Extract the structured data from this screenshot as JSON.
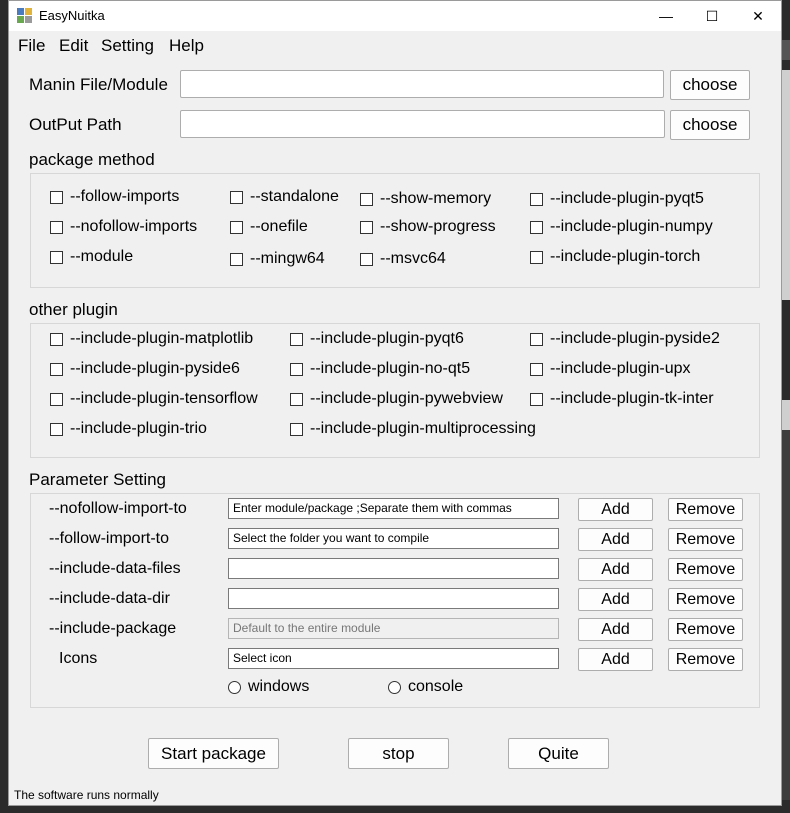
{
  "window": {
    "title": "EasyNuitka"
  },
  "titlebar": {
    "minimize": "—",
    "maximize": "☐",
    "close": "✕"
  },
  "menu": [
    "File",
    "Edit",
    "Setting",
    "Help"
  ],
  "main_file": {
    "label": "Manin File/Module",
    "value": "",
    "button": "choose"
  },
  "output_path": {
    "label": "OutPut Path",
    "value": "",
    "button": "choose"
  },
  "package_method": {
    "title": "package method",
    "options": [
      "--follow-imports",
      "--standalone",
      "--show-memory",
      "--include-plugin-pyqt5",
      "--nofollow-imports",
      "--onefile",
      "--show-progress",
      "--include-plugin-numpy",
      "--module",
      "--mingw64",
      "--msvc64",
      "--include-plugin-torch"
    ]
  },
  "other_plugin": {
    "title": "other plugin",
    "options": [
      "--include-plugin-matplotlib",
      "--include-plugin-pyqt6",
      "--include-plugin-pyside2",
      "--include-plugin-pyside6",
      "--include-plugin-no-qt5",
      "--include-plugin-upx",
      "--include-plugin-tensorflow",
      "--include-plugin-pywebview",
      "--include-plugin-tk-inter",
      "--include-plugin-trio",
      "--include-plugin-multiprocessing"
    ]
  },
  "parameters": {
    "title": "Parameter Setting",
    "add_label": "Add",
    "remove_label": "Remove",
    "rows": [
      {
        "label": "--nofollow-import-to",
        "value": "Enter module/package ;Separate them with commas"
      },
      {
        "label": "--follow-import-to",
        "value": "Select the folder you want to compile"
      },
      {
        "label": "--include-data-files",
        "value": ""
      },
      {
        "label": "--include-data-dir",
        "value": ""
      },
      {
        "label": "--include-package",
        "value": "Default to the entire module"
      },
      {
        "label": "Icons",
        "value": "Select  icon"
      }
    ],
    "mode_options": [
      "windows",
      "console"
    ]
  },
  "actions": {
    "start": "Start package",
    "stop": "stop",
    "quit": "Quite"
  },
  "status": "The software runs normally",
  "colors": {
    "window_bg": "#f0f0f0",
    "field_border": "#adadad",
    "titlebar_bg": "#ffffff"
  }
}
